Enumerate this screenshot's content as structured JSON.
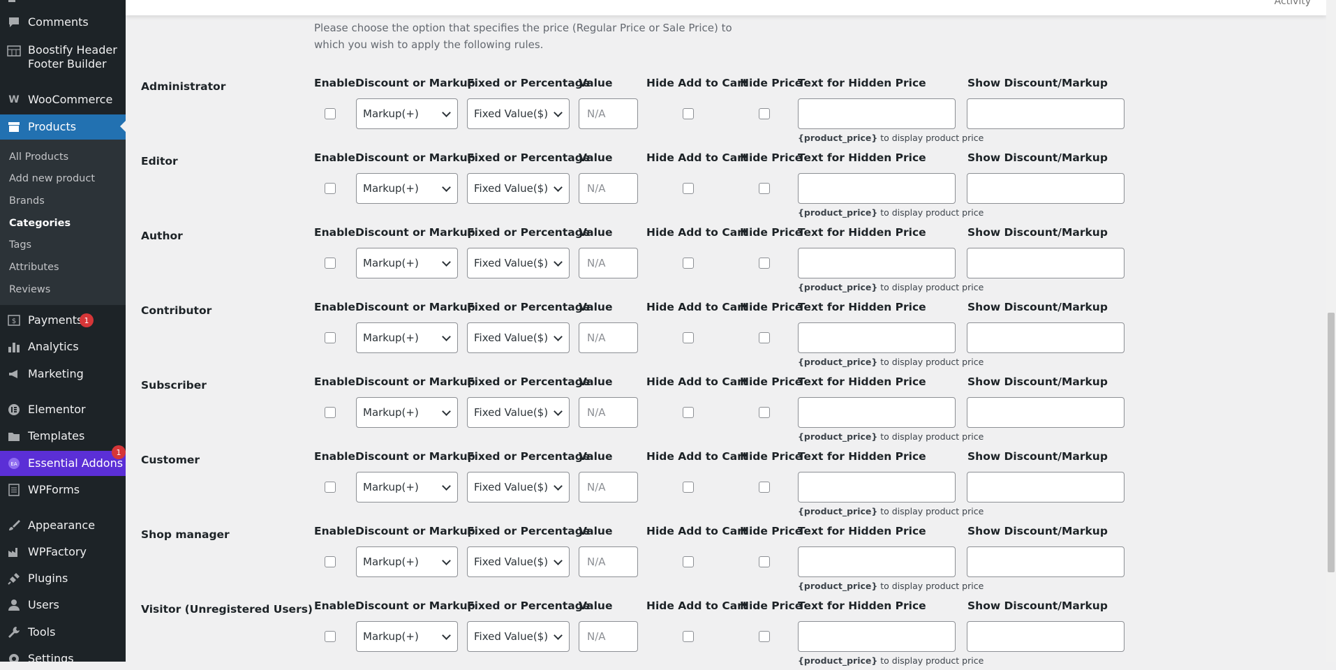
{
  "sidebar": {
    "menu": {
      "comments": "Comments",
      "boostify": "Boostify Header Footer Builder",
      "woocommerce": "WooCommerce",
      "products": "Products",
      "payments": "Payments",
      "analytics": "Analytics",
      "marketing": "Marketing",
      "elementor": "Elementor",
      "templates": "Templates",
      "essential_addons": "Essential Addons",
      "wpforms": "WPForms",
      "appearance": "Appearance",
      "wpfactory": "WPFactory",
      "plugins": "Plugins",
      "users": "Users",
      "tools": "Tools",
      "settings": "Settings"
    },
    "products_submenu": [
      "All Products",
      "Add new product",
      "Brands",
      "Categories",
      "Tags",
      "Attributes",
      "Reviews"
    ],
    "current_submenu": "Categories",
    "badges": {
      "payments": "1",
      "essential_addons": "1"
    },
    "colors": {
      "bg": "#1d2327",
      "active": "#2271b1",
      "essential_addons": "#5b2fd6",
      "badge": "#d63638"
    }
  },
  "topbar": {
    "activity": "Activity"
  },
  "intro_text": "Please choose the option that specifies the price (Regular Price or Sale Price) to which you wish to apply the following rules.",
  "columns": {
    "enable": "Enable",
    "discount_or_markup": "Discount or Markup",
    "fixed_or_percentage": "Fixed or Percentage",
    "value": "Value",
    "hide_add_to_cart": "Hide Add to Cart",
    "hide_price": "Hide Price",
    "text_hidden_price": "Text for Hidden Price",
    "show_discount_markup": "Show Discount/Markup"
  },
  "hint": {
    "token": "{product_price}",
    "text": " to display product price"
  },
  "roles": [
    {
      "name": "Administrator",
      "enable": false,
      "discount_or_markup": "Markup(+)",
      "fixed_or_percentage": "Fixed Value($)",
      "value_placeholder": "N/A",
      "hide_add_to_cart": false,
      "hide_price": false
    },
    {
      "name": "Editor",
      "enable": false,
      "discount_or_markup": "Markup(+)",
      "fixed_or_percentage": "Fixed Value($)",
      "value_placeholder": "N/A",
      "hide_add_to_cart": false,
      "hide_price": false
    },
    {
      "name": "Author",
      "enable": false,
      "discount_or_markup": "Markup(+)",
      "fixed_or_percentage": "Fixed Value($)",
      "value_placeholder": "N/A",
      "hide_add_to_cart": false,
      "hide_price": false
    },
    {
      "name": "Contributor",
      "enable": false,
      "discount_or_markup": "Markup(+)",
      "fixed_or_percentage": "Fixed Value($)",
      "value_placeholder": "N/A",
      "hide_add_to_cart": false,
      "hide_price": false
    },
    {
      "name": "Subscriber",
      "enable": false,
      "discount_or_markup": "Markup(+)",
      "fixed_or_percentage": "Fixed Value($)",
      "value_placeholder": "N/A",
      "hide_add_to_cart": false,
      "hide_price": false
    },
    {
      "name": "Customer",
      "enable": false,
      "discount_or_markup": "Markup(+)",
      "fixed_or_percentage": "Fixed Value($)",
      "value_placeholder": "N/A",
      "hide_add_to_cart": false,
      "hide_price": false
    },
    {
      "name": "Shop manager",
      "enable": false,
      "discount_or_markup": "Markup(+)",
      "fixed_or_percentage": "Fixed Value($)",
      "value_placeholder": "N/A",
      "hide_add_to_cart": false,
      "hide_price": false
    },
    {
      "name": "Visitor (Unregistered Users)",
      "enable": false,
      "discount_or_markup": "Markup(+)",
      "fixed_or_percentage": "Fixed Value($)",
      "value_placeholder": "N/A",
      "hide_add_to_cart": false,
      "hide_price": false
    }
  ]
}
